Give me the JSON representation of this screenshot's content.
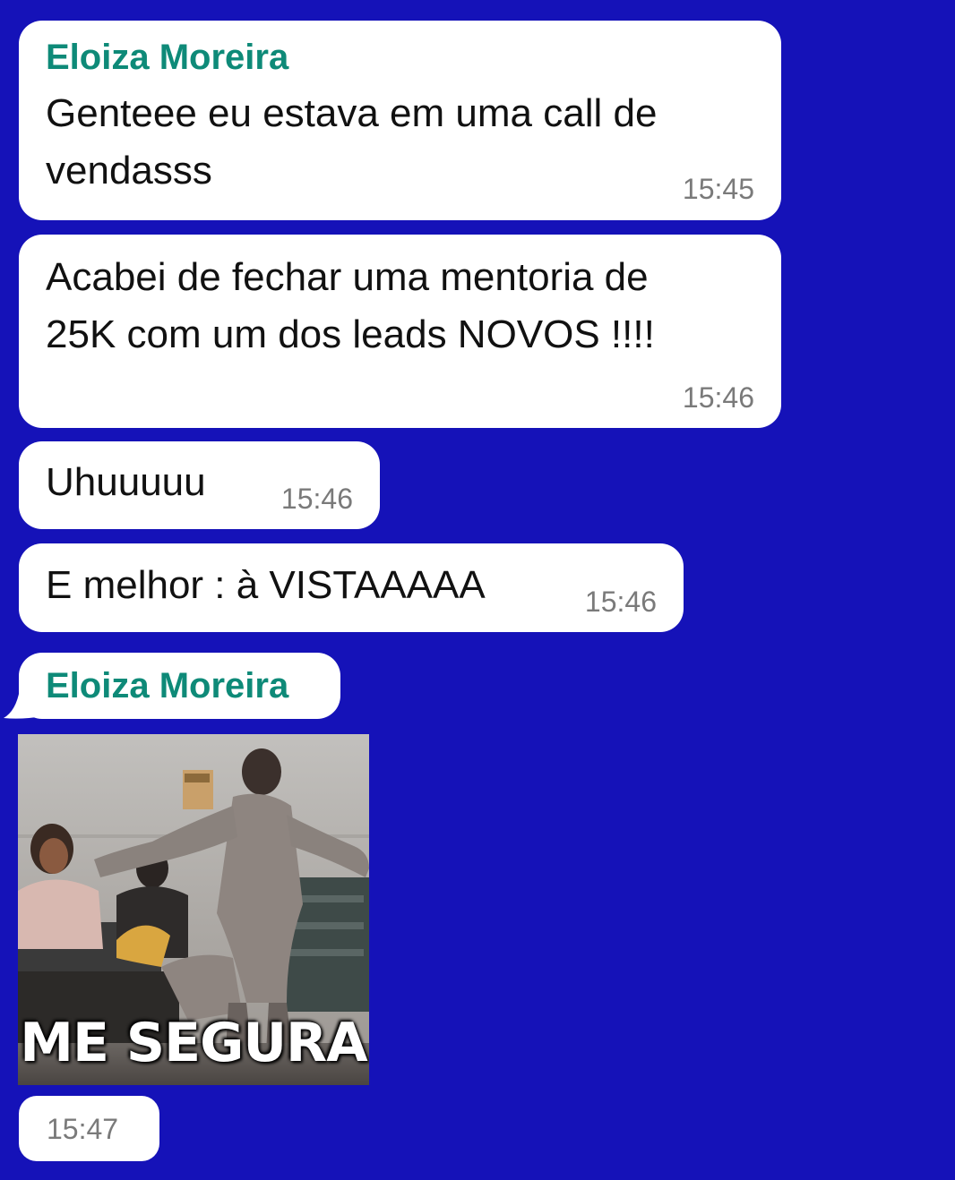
{
  "chat": {
    "messages": [
      {
        "sender": "Eloiza Moreira",
        "lines": [
          "Genteee eu estava em uma call de",
          "vendasss"
        ],
        "time": "15:45"
      },
      {
        "lines": [
          "Acabei de fechar uma mentoria de",
          "25K com um dos leads NOVOS !!!!"
        ],
        "time": "15:46"
      },
      {
        "lines": [
          "Uhuuuuu"
        ],
        "time": "15:46"
      },
      {
        "lines": [
          "E melhor : à VISTAAAAA"
        ],
        "time": "15:46"
      },
      {
        "sender": "Eloiza Moreira",
        "gif": {
          "caption": "ME SEGURA",
          "icon": "dancing-man-gif"
        },
        "time": "15:47"
      }
    ]
  },
  "colors": {
    "background": "#1512b8",
    "bubble": "#ffffff",
    "sender_name": "#0e8a78",
    "message_text": "#111111",
    "timestamp": "#7a7a7a"
  }
}
